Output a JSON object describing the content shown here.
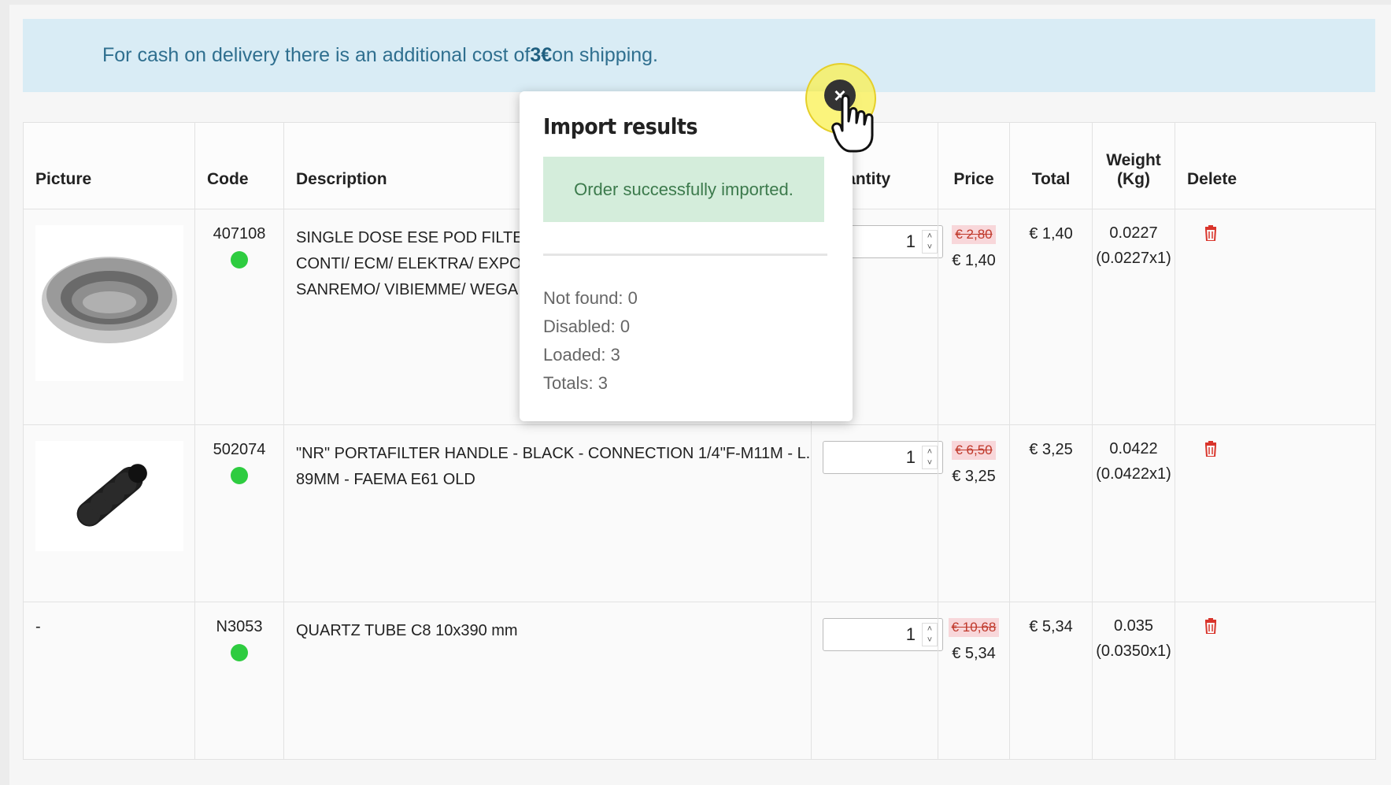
{
  "notice": {
    "text": "For cash on delivery there is an additional cost of ",
    "amount": "3€",
    "suffix": " on shipping."
  },
  "table": {
    "headers": {
      "picture": "Picture",
      "code": "Code",
      "description": "Description",
      "quantity": "Quantity",
      "price": "Price",
      "total": "Total",
      "weight_line1": "Weight",
      "weight_line2": "(Kg)",
      "delete": "Delete"
    },
    "rows": [
      {
        "picture": "",
        "code": "407108",
        "description": "SINGLE DOSE ESE POD FILTER ASTORIA CMA/BRUGNETTI/BE CONTI/ ECM/ ELEKTRA/ EXPOB MARZOCCO/ NUOVA SIMONE SANREMO/ VIBIEMME/ WEGA",
        "quantity": "1",
        "old_price": "€ 2,80",
        "price": "€ 1,40",
        "total": "€ 1,40",
        "weight": "0.0227",
        "weight_detail": "(0.0227x1)"
      },
      {
        "picture": "",
        "code": "502074",
        "description": "\"NR\" PORTAFILTER HANDLE - BLACK - CONNECTION 1/4\"F-M11M - L. 89mm - FAEMA E61 OLD",
        "quantity": "1",
        "old_price": "€ 6,50",
        "price": "€ 3,25",
        "total": "€ 3,25",
        "weight": "0.0422",
        "weight_detail": "(0.0422x1)"
      },
      {
        "picture": "-",
        "code": "N3053",
        "description": "QUARTZ TUBE C8 10x390 mm",
        "quantity": "1",
        "old_price": "€ 10,68",
        "price": "€ 5,34",
        "total": "€ 5,34",
        "weight": "0.035",
        "weight_detail": "(0.0350x1)"
      }
    ]
  },
  "modal": {
    "title": "Import results",
    "success": "Order successfully imported.",
    "not_found": "Not found: 0",
    "disabled": "Disabled: 0",
    "loaded": "Loaded: 3",
    "totals": "Totals: 3",
    "close": "×"
  },
  "colors": {
    "notice_bg": "#d9ecf5",
    "success_bg": "#d4eddb",
    "stock_dot": "#2ecc40",
    "delete": "#d9342b"
  },
  "icons": {
    "delete": "trash-icon",
    "close": "close-icon",
    "stock": "in-stock-dot",
    "cursor": "hand-pointer-icon"
  }
}
